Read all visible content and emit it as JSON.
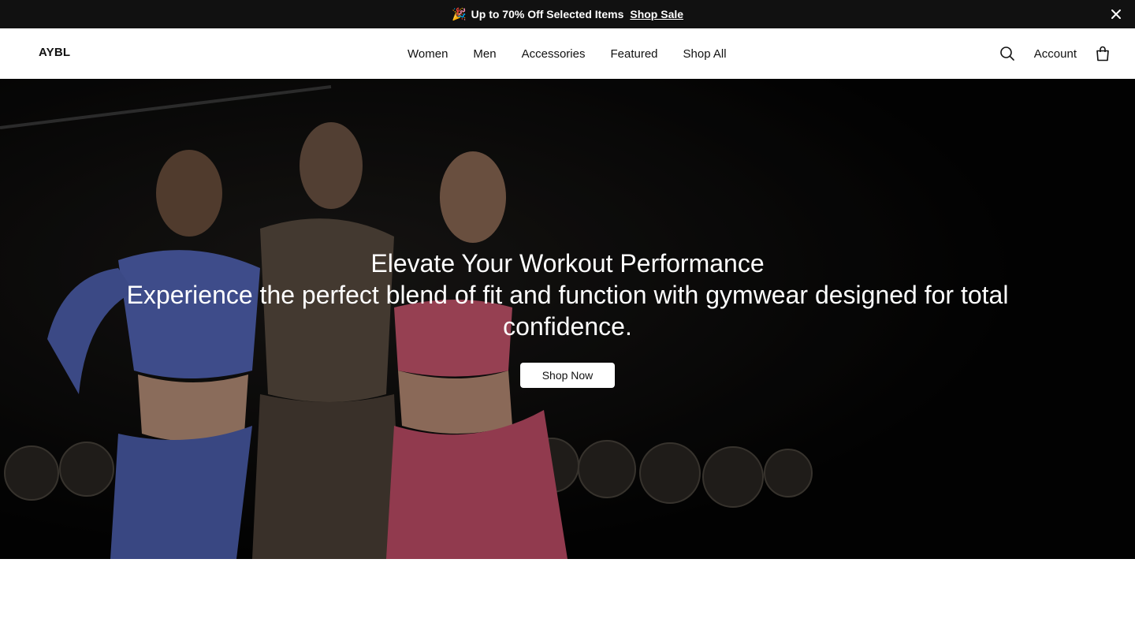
{
  "announcement": {
    "emoji": "🎉",
    "text": "Up to 70% Off Selected Items",
    "link_label": "Shop Sale"
  },
  "header": {
    "logo": "AYBL",
    "nav": [
      "Women",
      "Men",
      "Accessories",
      "Featured",
      "Shop All"
    ],
    "account_label": "Account",
    "icons": [
      "search-icon",
      "bag-icon",
      "close-icon"
    ]
  },
  "hero": {
    "title": "Elevate Your Workout Performance",
    "subtitle": "Experience the perfect blend of fit and function with gymwear designed for total confidence.",
    "cta_label": "Shop Now"
  },
  "colors": {
    "announcement_bg": "#111111",
    "hero_bg": "#050505",
    "cta_bg": "#ffffff",
    "text_dark": "#111111"
  }
}
